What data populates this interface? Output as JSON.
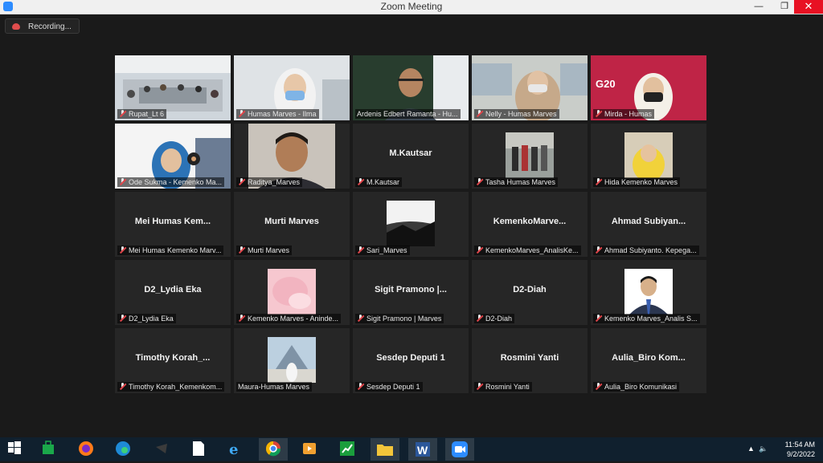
{
  "window": {
    "title": "Zoom Meeting"
  },
  "recording": {
    "label": "Recording..."
  },
  "participants": [
    {
      "name": "Rupat_Lt 6",
      "big": ""
    },
    {
      "name": "Humas Marves - Ilma",
      "big": ""
    },
    {
      "name": "Ardenis Edbert Ramanta - Hu...",
      "big": ""
    },
    {
      "name": "Nelly - Humas Marves",
      "big": ""
    },
    {
      "name": "Mirda - Humas",
      "big": ""
    },
    {
      "name": "Ode Sukma - Kemenko Ma...",
      "big": ""
    },
    {
      "name": "Raditya_Marves",
      "big": ""
    },
    {
      "name": "M.Kautsar",
      "big": "M.Kautsar"
    },
    {
      "name": "Tasha Humas Marves",
      "big": ""
    },
    {
      "name": "Hida Kemenko Marves",
      "big": ""
    },
    {
      "name": "Mei Humas Kemenko Marv...",
      "big": "Mei Humas Kem..."
    },
    {
      "name": "Murti Marves",
      "big": "Murti Marves"
    },
    {
      "name": "Sari_Marves",
      "big": ""
    },
    {
      "name": "KemenkoMarves_AnalisKe...",
      "big": "KemenkoMarve..."
    },
    {
      "name": "Ahmad Subiyanto. Kepega...",
      "big": "Ahmad Subiyan..."
    },
    {
      "name": "D2_Lydia Eka",
      "big": "D2_Lydia Eka"
    },
    {
      "name": "Kemenko Marves - Aninde...",
      "big": ""
    },
    {
      "name": "Sigit Pramono | Marves",
      "big": "Sigit Pramono |..."
    },
    {
      "name": "D2-Diah",
      "big": "D2-Diah"
    },
    {
      "name": "Kemenko Marves_Analis S...",
      "big": ""
    },
    {
      "name": "Timothy Korah_Kemenkom...",
      "big": "Timothy Korah_..."
    },
    {
      "name": "Maura-Humas Marves",
      "big": ""
    },
    {
      "name": "Sesdep Deputi 1",
      "big": "Sesdep Deputi 1"
    },
    {
      "name": "Rosmini Yanti",
      "big": "Rosmini Yanti"
    },
    {
      "name": "Aulia_Biro Komunikasi",
      "big": "Aulia_Biro Kom..."
    }
  ],
  "video_text": {
    "g20": "G20"
  },
  "taskbar": {
    "time": "11:54 AM",
    "date": "9/2/2022"
  },
  "colors": {
    "active_speaker": "#c4ea54",
    "tile_bg": "#262626",
    "taskbar": "#10202e"
  }
}
